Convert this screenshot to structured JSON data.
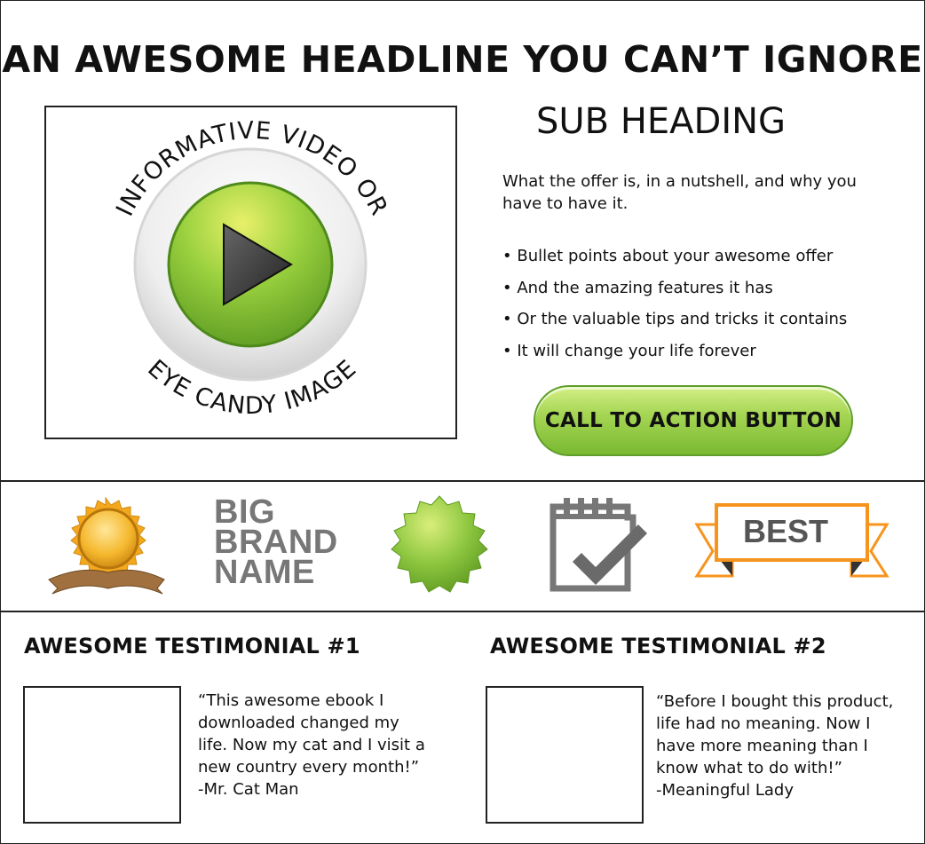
{
  "headline": "AN AWESOME HEADLINE YOU CAN’T IGNORE",
  "video": {
    "top_arc_text": "INFORMATIVE VIDEO OR",
    "bottom_arc_text": "EYE CANDY IMAGE",
    "icon": "play-icon"
  },
  "sub_heading": "SUB HEADING",
  "description": "What the offer is, in a nutshell, and why you have to have it.",
  "bullets": [
    "• Bullet points about your awesome offer",
    "• And the amazing features it has",
    "• Or the valuable tips and tricks it contains",
    "• It will change your life forever"
  ],
  "cta_label": "CALL TO ACTION BUTTON",
  "trust": {
    "brand_lines": [
      "BIG",
      "BRAND",
      "NAME"
    ],
    "ribbon_label": "BEST",
    "icons": [
      "award-medal-icon",
      "brand-name-logo",
      "seal-badge-icon",
      "calendar-check-icon",
      "best-ribbon-icon"
    ]
  },
  "testimonials": [
    {
      "title": "AWESOME TESTIMONIAL #1",
      "quote": "“This awesome ebook I\ndownloaded changed my\nlife. Now my cat and I visit a\nnew country every month!”\n-Mr. Cat Man"
    },
    {
      "title": "AWESOME TESTIMONIAL #2",
      "quote": "“Before I bought this product,\nlife had no meaning. Now I\nhave more meaning than I\nknow what to do with!”\n-Meaningful Lady"
    }
  ],
  "colors": {
    "accent_green": "#8cc63f",
    "gold": "#f0a820",
    "ribbon_orange": "#f7941d",
    "icon_gray": "#777777"
  }
}
